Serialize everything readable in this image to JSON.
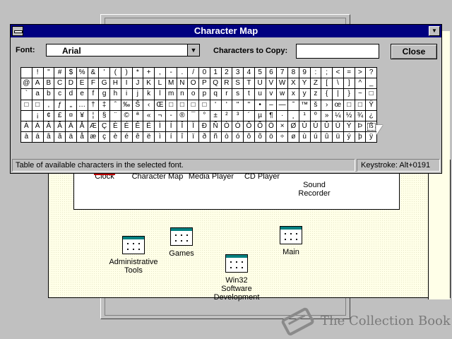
{
  "character_map": {
    "title": "Character Map",
    "font_label": "Font:",
    "font_value": "Arial",
    "copy_label": "Characters to Copy:",
    "copy_value": "",
    "close_label": "Close",
    "status_text": "Table of available characters in the selected font.",
    "keystroke_text": "Keystroke: Alt+0191",
    "selected_row": 5,
    "selected_col": 31,
    "grid": [
      [
        " ",
        "!",
        "\"",
        "#",
        "$",
        "%",
        "&",
        "'",
        "(",
        ")",
        "*",
        "+",
        ",",
        "-",
        ".",
        "/",
        "0",
        "1",
        "2",
        "3",
        "4",
        "5",
        "6",
        "7",
        "8",
        "9",
        ":",
        ";",
        "<",
        "=",
        ">",
        "?"
      ],
      [
        "@",
        "A",
        "B",
        "C",
        "D",
        "E",
        "F",
        "G",
        "H",
        "I",
        "J",
        "K",
        "L",
        "M",
        "N",
        "O",
        "P",
        "Q",
        "R",
        "S",
        "T",
        "U",
        "V",
        "W",
        "X",
        "Y",
        "Z",
        "[",
        "\\",
        "]",
        "^",
        "_"
      ],
      [
        "`",
        "a",
        "b",
        "c",
        "d",
        "e",
        "f",
        "g",
        "h",
        "i",
        "j",
        "k",
        "l",
        "m",
        "n",
        "o",
        "p",
        "q",
        "r",
        "s",
        "t",
        "u",
        "v",
        "w",
        "x",
        "y",
        "z",
        "{",
        "|",
        "}",
        "~",
        "□"
      ],
      [
        "□",
        "□",
        ",",
        "ƒ",
        "„",
        "…",
        "†",
        "‡",
        "ˆ",
        "‰",
        "Š",
        "‹",
        "Œ",
        "□",
        "□",
        "□",
        "□",
        "'",
        "'",
        "\"",
        "\"",
        "•",
        "–",
        "—",
        "˜",
        "™",
        "š",
        "›",
        "œ",
        "□",
        "□",
        "Ÿ"
      ],
      [
        " ",
        "¡",
        "¢",
        "£",
        "¤",
        "¥",
        "¦",
        "§",
        "¨",
        "©",
        "ª",
        "«",
        "¬",
        "-",
        "®",
        "¯",
        "°",
        "±",
        "²",
        "³",
        "´",
        "µ",
        "¶",
        "·",
        "¸",
        "¹",
        "º",
        "»",
        "¼",
        "½",
        "¾",
        "¿"
      ],
      [
        "À",
        "Á",
        "Â",
        "Ã",
        "Ä",
        "Å",
        "Æ",
        "Ç",
        "È",
        "É",
        "Ê",
        "Ë",
        "Ì",
        "Í",
        "Î",
        "Ï",
        "Ð",
        "Ñ",
        "Ò",
        "Ó",
        "Ô",
        "Õ",
        "Ö",
        "×",
        "Ø",
        "Ù",
        "Ú",
        "Û",
        "Ü",
        "Ý",
        "Þ",
        "ß"
      ],
      [
        "à",
        "á",
        "â",
        "ã",
        "ä",
        "å",
        "æ",
        "ç",
        "è",
        "é",
        "ê",
        "ë",
        "ì",
        "í",
        "î",
        "ï",
        "ð",
        "ñ",
        "ò",
        "ó",
        "ô",
        "õ",
        "ö",
        "÷",
        "ø",
        "ù",
        "ú",
        "û",
        "ü",
        "ý",
        "þ",
        "ÿ"
      ]
    ]
  },
  "accessories_icons": [
    {
      "name": "clock-icon",
      "label": "Clock"
    },
    {
      "name": "character-map-icon",
      "label": "Character Map"
    },
    {
      "name": "media-player-icon",
      "label": "Media Player"
    },
    {
      "name": "cd-player-icon",
      "label": "CD Player"
    },
    {
      "name": "sound-recorder-icon",
      "label": "Sound\nRecorder"
    }
  ],
  "program_groups": [
    {
      "name": "group-administrative-tools",
      "label": "Administrative\nTools"
    },
    {
      "name": "group-games",
      "label": "Games"
    },
    {
      "name": "group-main",
      "label": "Main"
    },
    {
      "name": "group-win32-sdk",
      "label": "Win32\nSoftware\nDevelopment"
    }
  ],
  "watermark": {
    "text": "The Collection Book",
    "icon": "book-icon"
  },
  "colors": {
    "titlebar": "#000080",
    "desktop": "#c0c0c0",
    "group_bg": "#ffffe8"
  }
}
